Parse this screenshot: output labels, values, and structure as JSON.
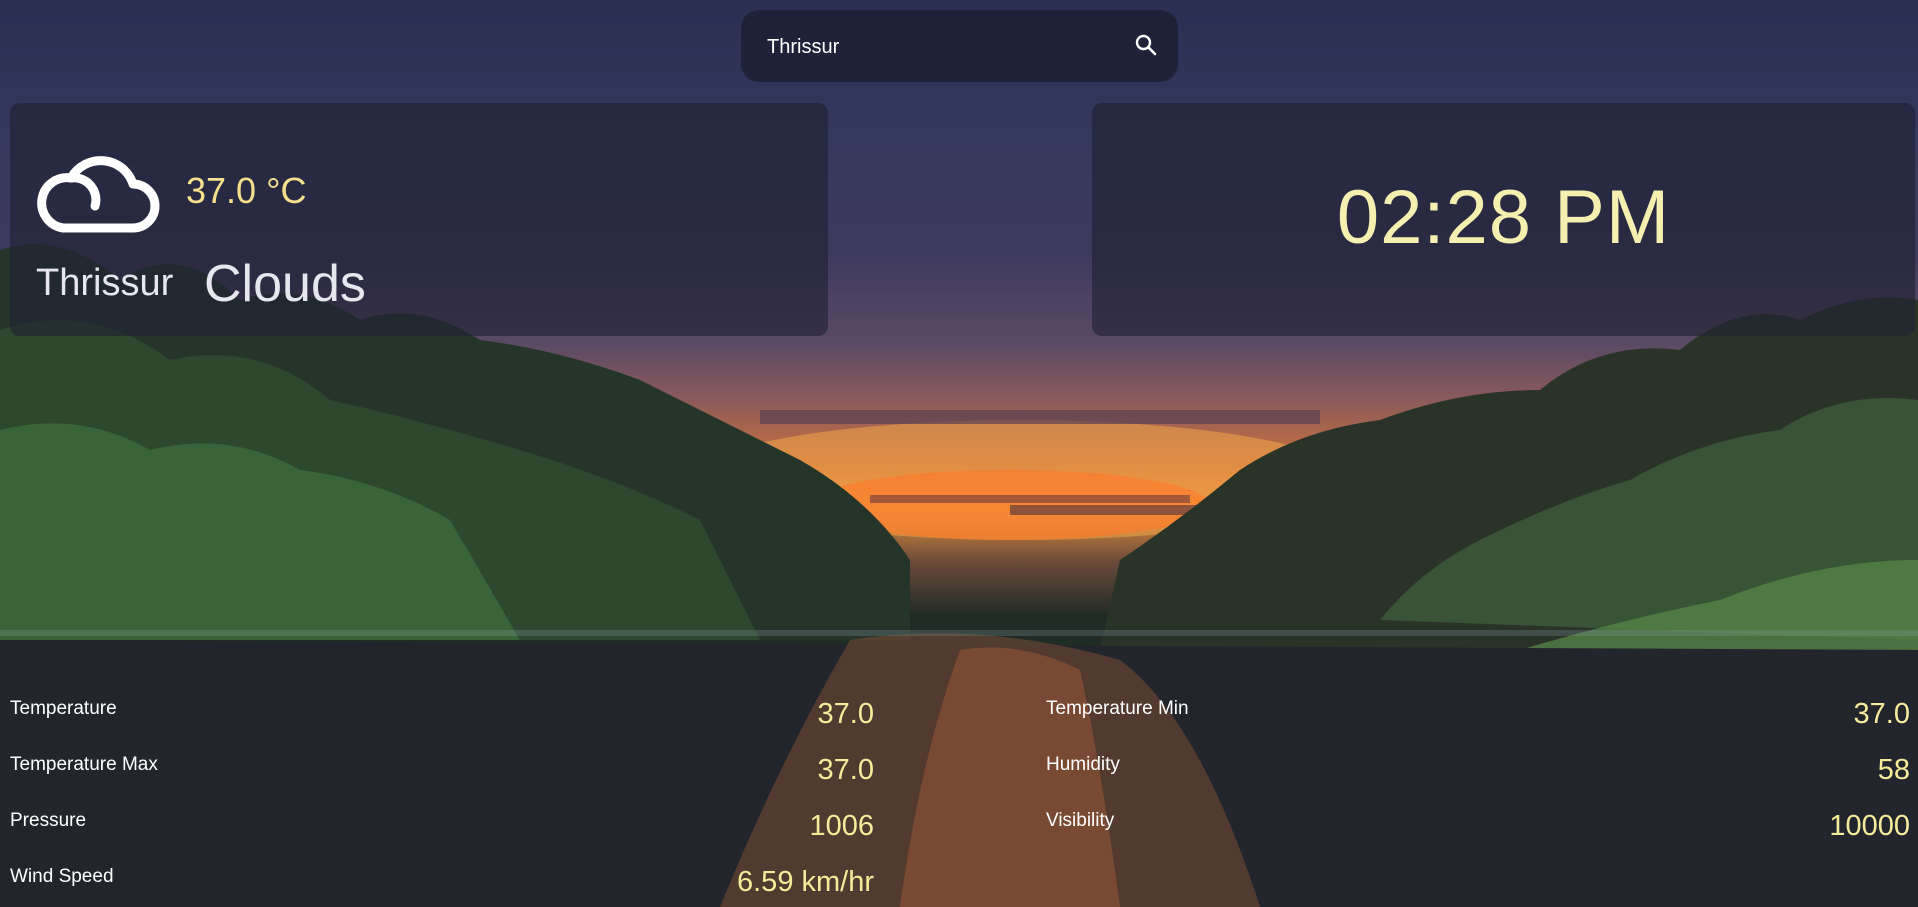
{
  "search": {
    "value": "Thrissur",
    "icon": "search-icon"
  },
  "weather": {
    "icon": "cloud-icon",
    "temperature": "37.0 °C",
    "city": "Thrissur",
    "condition": "Clouds"
  },
  "clock": {
    "time": "02:28 PM"
  },
  "stats": [
    {
      "label": "Temperature",
      "value": "37.0"
    },
    {
      "label": "Temperature Max",
      "value": "37.0"
    },
    {
      "label": "Pressure",
      "value": "1006"
    },
    {
      "label": "Wind Speed",
      "value": "6.59 km/hr"
    },
    {
      "label": "Temperature Min",
      "value": "37.0"
    },
    {
      "label": "Humidity",
      "value": "58"
    },
    {
      "label": "Visibility",
      "value": "10000"
    }
  ],
  "colors": {
    "accent_value": "#f6eb9a",
    "clock": "#f6f0b0",
    "panel": "rgba(30,32,50,0.62)"
  }
}
